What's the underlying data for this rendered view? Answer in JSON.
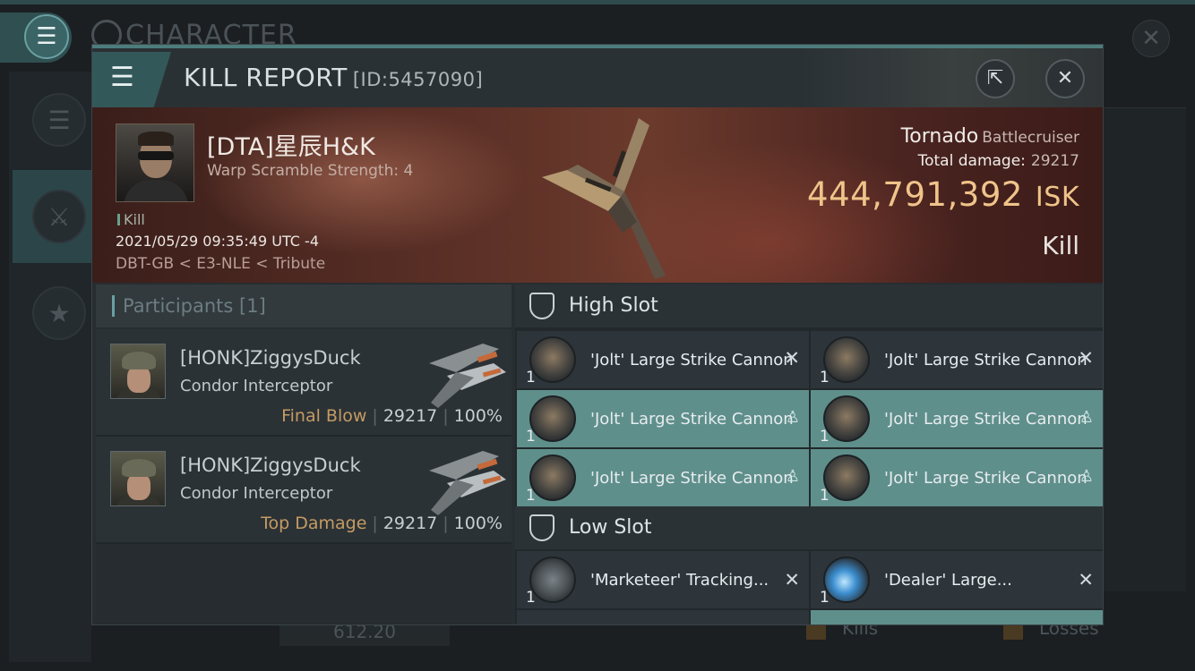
{
  "background": {
    "window_title": "CHARACTER",
    "footer": {
      "value": "612.20",
      "kills_label": "Kills",
      "losses_label": "Losses"
    }
  },
  "kill_report": {
    "title": "KILL REPORT",
    "id_label": "[ID:5457090]",
    "victim": {
      "name": "[DTA]星辰H&K",
      "warp_scramble": "Warp Scramble Strength: 4",
      "tag": "Kill",
      "datetime": "2021/05/29 09:35:49 UTC -4",
      "location": "DBT-GB < E3-NLE < Tribute"
    },
    "ship": {
      "name": "Tornado",
      "class": "Battlecruiser",
      "total_damage_label": "Total damage:",
      "total_damage": "29217",
      "isk_value": "444,791,392",
      "isk_unit": "ISK",
      "result": "Kill"
    },
    "participants": {
      "header": "Participants [1]",
      "rows": [
        {
          "name": "[HONK]ZiggysDuck",
          "ship": "Condor Interceptor",
          "role": "Final Blow",
          "damage": "29217",
          "percent": "100%"
        },
        {
          "name": "[HONK]ZiggysDuck",
          "ship": "Condor Interceptor",
          "role": "Top Damage",
          "damage": "29217",
          "percent": "100%"
        }
      ]
    },
    "fitting": {
      "high_slot_label": "High Slot",
      "low_slot_label": "Low Slot",
      "high_modules": [
        {
          "name": "'Jolt' Large Strike Cannon",
          "qty": "1",
          "status": "destroyed"
        },
        {
          "name": "'Jolt' Large Strike Cannon",
          "qty": "1",
          "status": "destroyed"
        },
        {
          "name": "'Jolt' Large Strike Cannon",
          "qty": "1",
          "status": "dropped"
        },
        {
          "name": "'Jolt' Large Strike Cannon",
          "qty": "1",
          "status": "dropped"
        },
        {
          "name": "'Jolt' Large Strike Cannon",
          "qty": "1",
          "status": "dropped"
        },
        {
          "name": "'Jolt' Large Strike Cannon",
          "qty": "1",
          "status": "dropped"
        }
      ],
      "low_modules": [
        {
          "name": "'Marketeer' Tracking...",
          "qty": "1",
          "status": "destroyed"
        },
        {
          "name": "'Dealer' Large...",
          "qty": "1",
          "status": "destroyed"
        }
      ]
    }
  }
}
